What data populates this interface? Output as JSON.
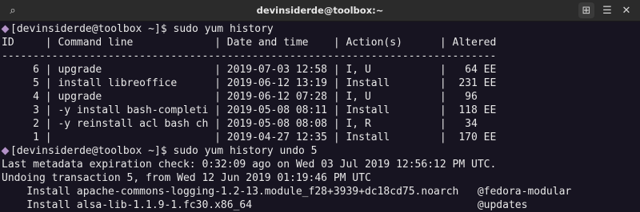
{
  "window": {
    "title": "devinsiderde@toolbox:~"
  },
  "icons": {
    "search": "search-icon",
    "new_tab": "new-tab-icon",
    "menu": "hamburger-menu-icon",
    "close": "close-icon"
  },
  "icon_glyphs": {
    "search": "⌕",
    "new_tab": "⊞",
    "menu": "☰",
    "close": "✕"
  },
  "colors": {
    "terminal_bg": "#171421",
    "text": "#e8e8e8",
    "prompt_marker": "#b392c8",
    "titlebar_bg": "#2b2b2b"
  },
  "terminal": {
    "prompt1": "[devinsiderde@toolbox ~]$ ",
    "cmd1": "sudo yum history",
    "header": "ID     | Command line             | Date and time    | Action(s)      | Altered",
    "separator": "-------------------------------------------------------------------------------",
    "history_rows": [
      "     6 | upgrade                  | 2019-07-03 12:58 | I, U           |   64 EE",
      "     5 | install libreoffice      | 2019-06-12 13:19 | Install        |  231 EE",
      "     4 | upgrade                  | 2019-06-12 07:28 | I, U           |   96",
      "     3 | -y install bash-completi | 2019-05-08 08:11 | Install        |  118 EE",
      "     2 | -y reinstall acl bash ch | 2019-05-08 08:08 | I, R           |   34",
      "     1 |                          | 2019-04-27 12:35 | Install        |  170 EE"
    ],
    "prompt2": "[devinsiderde@toolbox ~]$ ",
    "cmd2": "sudo yum history undo 5",
    "output_lines": [
      "Last metadata expiration check: 0:32:09 ago on Wed 03 Jul 2019 12:56:12 PM UTC.",
      "Undoing transaction 5, from Wed 12 Jun 2019 01:19:46 PM UTC",
      "    Install apache-commons-logging-1.2-13.module_f28+3939+dc18cd75.noarch   @fedora-modular",
      "    Install alsa-lib-1.1.9-1.fc30.x86_64                                    @updates"
    ]
  }
}
